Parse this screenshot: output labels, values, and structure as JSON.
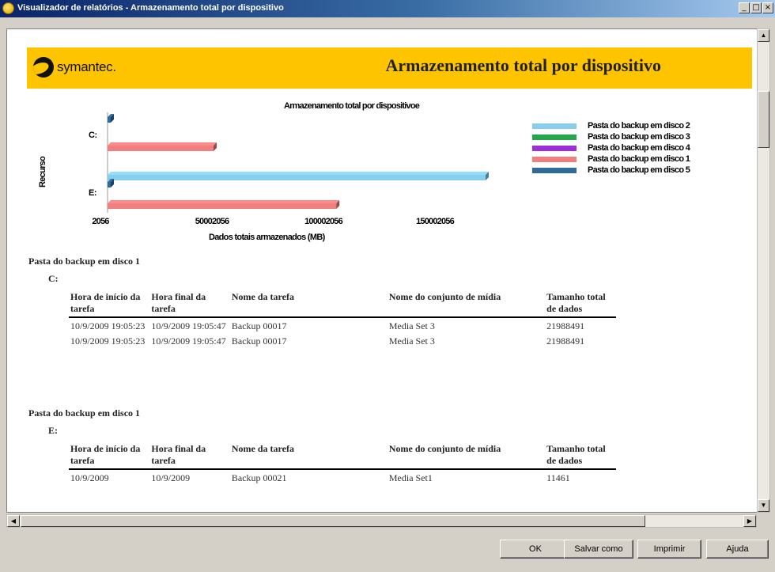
{
  "window": {
    "title": "Visualizador de relatórios - Armazenamento total por dispositivo",
    "controls": [
      "_",
      "□",
      "×"
    ]
  },
  "report": {
    "logo_text": "symantec.",
    "banner_title": "Armazenamento total por dispositivo"
  },
  "chart_data": {
    "type": "bar",
    "orientation": "horizontal",
    "title": "Armazenamento total por dispositivoe",
    "xlabel": "Dados totais armazenados (MB)",
    "ylabel": "Recurso",
    "categories": [
      "C:",
      "E:"
    ],
    "x_ticks": [
      "2056",
      "50002056",
      "100002056",
      "150002056"
    ],
    "xlim": [
      2056,
      160000000
    ],
    "legend_position": "right",
    "series": [
      {
        "name": "Pasta do backup em disco 2",
        "color": "#87ceeb",
        "values": [
          0,
          157000000
        ]
      },
      {
        "name": "Pasta do backup em disco 3",
        "color": "#22a84a",
        "values": [
          0,
          0
        ]
      },
      {
        "name": "Pasta do backup em disco 4",
        "color": "#9b30d9",
        "values": [
          0,
          0
        ]
      },
      {
        "name": "Pasta do backup em disco 1",
        "color": "#f08080",
        "values": [
          44000000,
          95000000
        ]
      },
      {
        "name": "Pasta do backup em disco 5",
        "color": "#2e6a9c",
        "values": [
          1200000,
          1200000
        ]
      }
    ]
  },
  "table_headers": [
    "Hora de início da tarefa",
    "Hora final da tarefa",
    "Nome da tarefa",
    "Nome do conjunto de mídia",
    "Tamanho total de dados"
  ],
  "sections": [
    {
      "title": "Pasta do backup em disco 1",
      "device": "C:",
      "rows": [
        [
          "10/9/2009 19:05:23",
          "10/9/2009 19:05:47",
          "Backup 00017",
          "Media Set 3",
          "21988491"
        ],
        [
          "10/9/2009 19:05:23",
          "10/9/2009 19:05:47",
          "Backup 00017",
          "Media Set 3",
          "21988491"
        ]
      ]
    },
    {
      "title": "Pasta do backup em disco 1",
      "device": "E:",
      "rows": [
        [
          "10/9/2009",
          "10/9/2009",
          "Backup 00021",
          "Media Set1",
          "11461"
        ]
      ]
    }
  ],
  "buttons": {
    "ok": "OK",
    "save_as": "Salvar como",
    "print": "Imprimir",
    "help": "Ajuda"
  }
}
